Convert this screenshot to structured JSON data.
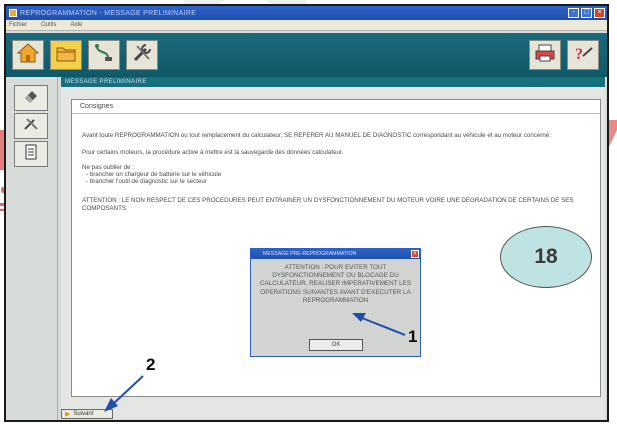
{
  "window": {
    "title": "REPROGRAMMATION - MESSAGE PRELIMINAIRE",
    "menu": [
      "Fichier",
      "Outils",
      "Aide"
    ],
    "controls": [
      "-",
      "□",
      "×"
    ]
  },
  "toolbar": {
    "buttons": [
      "home-icon",
      "folder-icon",
      "diagnostic-icon",
      "tools-icon",
      "print-icon",
      "help-icon"
    ]
  },
  "sidebar": {
    "buttons": [
      "eraser-icon",
      "tools-icon",
      "document-icon"
    ]
  },
  "section": {
    "title": "MESSAGE PRELIMINAIRE"
  },
  "pane": {
    "title": "Consignes",
    "lines": [
      "Avant toute REPROGRAMMATION ou tout remplacement du calculateur, SE REFERER AU MANUEL DE DIAGNOSTIC correspondant au véhicule et au moteur concerné.",
      "Pour certains moteurs, la procédure active à mettre est la sauvegarde des données calculateur.",
      "Ne pas oublier de :",
      "- brancher un chargeur de batterie sur le véhicule",
      "- brancher l'outil de diagnostic sur le secteur",
      "ATTENTION : LE NON RESPECT DE CES PROCEDURES PEUT ENTRAINER UN DYSFONCTIONNEMENT DU MOTEUR VOIRE UNE DEGRADATION DE CERTAINS DE SES COMPOSANTS."
    ]
  },
  "dialog": {
    "title": "MESSAGE PRE-REPROGRAMMATION",
    "message": "ATTENTION : POUR EVITER TOUT DYSFONCTIONNEMENT OU BLOCAGE DU CALCULATEUR, REALISER IMPERATIVEMENT LES OPERATIONS SUIVANTES AVANT D'EXECUTER LA REPROGRAMMATION",
    "ok_label": "OK",
    "close_label": "×"
  },
  "footer": {
    "next_label": "Suivant"
  },
  "annotations": {
    "callout": "18",
    "arrow1": "1",
    "arrow2": "2"
  },
  "watermark": {
    "text": "ن يـ"
  }
}
